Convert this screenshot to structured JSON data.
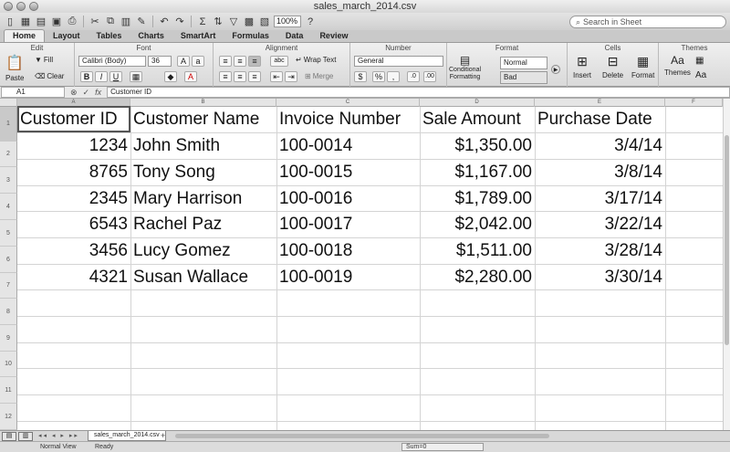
{
  "window": {
    "title": "sales_march_2014.csv"
  },
  "toolbar": {
    "zoom": "100%",
    "search_placeholder": "Search in Sheet"
  },
  "ribbon": {
    "tabs": [
      "Home",
      "Layout",
      "Tables",
      "Charts",
      "SmartArt",
      "Formulas",
      "Data",
      "Review"
    ],
    "groups": {
      "edit": "Edit",
      "font": "Font",
      "alignment": "Alignment",
      "number": "Number",
      "format": "Format",
      "cells": "Cells",
      "themes": "Themes"
    },
    "paste": "Paste",
    "fill": "Fill",
    "clear": "Clear",
    "font_name": "Calibri (Body)",
    "font_size": "36",
    "wrap_text": "Wrap Text",
    "merge": "Merge",
    "number_format": "General",
    "conditional": "Conditional",
    "formatting": "Formatting",
    "style_normal": "Normal",
    "style_bad": "Bad",
    "insert": "Insert",
    "delete": "Delete",
    "format": "Format",
    "themes": "Themes",
    "bold": "B",
    "italic": "I",
    "underline": "U",
    "abc": "abc",
    "aa": "Aa"
  },
  "formula_bar": {
    "cell_ref": "A1",
    "content": "Customer ID",
    "fx": "fx"
  },
  "grid": {
    "columns": [
      "A",
      "B",
      "C",
      "D",
      "E",
      "F"
    ],
    "rows": [
      "1",
      "2",
      "3",
      "4",
      "5",
      "6",
      "7",
      "8",
      "9",
      "10",
      "11",
      "12"
    ],
    "headers": [
      "Customer ID",
      "Customer Name",
      "Invoice Number",
      "Sale Amount",
      "Purchase Date"
    ],
    "data": [
      [
        "1234",
        "John Smith",
        "100-0014",
        "$1,350.00",
        "3/4/14"
      ],
      [
        "8765",
        "Tony Song",
        "100-0015",
        "$1,167.00",
        "3/8/14"
      ],
      [
        "2345",
        "Mary Harrison",
        "100-0016",
        "$1,789.00",
        "3/17/14"
      ],
      [
        "6543",
        "Rachel Paz",
        "100-0017",
        "$2,042.00",
        "3/22/14"
      ],
      [
        "3456",
        "Lucy Gomez",
        "100-0018",
        "$1,511.00",
        "3/28/14"
      ],
      [
        "4321",
        "Susan Wallace",
        "100-0019",
        "$2,280.00",
        "3/30/14"
      ]
    ]
  },
  "sheet_tabs": {
    "active": "sales_march_2014.csv",
    "add": "+"
  },
  "status": {
    "view": "Normal View",
    "ready": "Ready",
    "sum": "Sum=0"
  }
}
